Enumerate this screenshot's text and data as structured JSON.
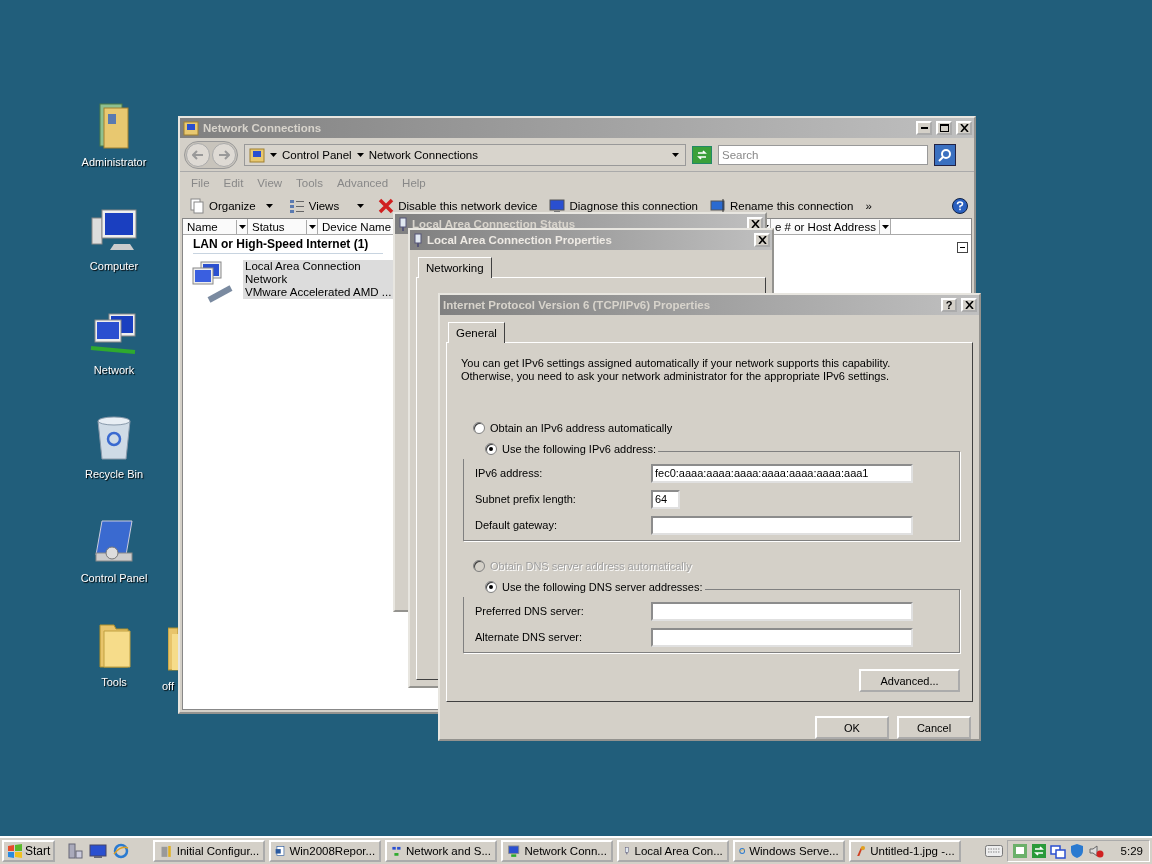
{
  "desktop_icons": [
    {
      "label": "Administrator",
      "kind": "user-folder"
    },
    {
      "label": "Computer",
      "kind": "computer"
    },
    {
      "label": "Network",
      "kind": "network"
    },
    {
      "label": "Recycle Bin",
      "kind": "bin"
    },
    {
      "label": "Control Panel",
      "kind": "control"
    },
    {
      "label": "Tools",
      "kind": "folder"
    }
  ],
  "hidden_icon": {
    "label": "off"
  },
  "explorer": {
    "title": "Network Connections",
    "breadcrumb": [
      "Control Panel",
      "Network Connections"
    ],
    "search": {
      "placeholder": "Search"
    },
    "menu": [
      "File",
      "Edit",
      "View",
      "Tools",
      "Advanced",
      "Help"
    ],
    "toolbar": [
      {
        "label": "Organize",
        "kind": "organize"
      },
      {
        "label": "Views",
        "kind": "views"
      },
      {
        "label": "Disable this network device",
        "kind": "disable"
      },
      {
        "label": "Diagnose this connection",
        "kind": "diagnose"
      },
      {
        "label": "Rename this connection",
        "kind": "rename"
      },
      {
        "label": "»",
        "kind": "more"
      }
    ],
    "columns": [
      "Name",
      "Status",
      "Device Name",
      "e # or Host Address"
    ],
    "group": {
      "title": "LAN or High-Speed Internet (1)",
      "expanded": true
    },
    "items": [
      {
        "lines": [
          "Local Area Connection",
          "Network",
          "VMware Accelerated AMD ..."
        ],
        "selected": true
      }
    ]
  },
  "status_dialog": {
    "title": "Local Area Connection Status"
  },
  "properties_dialog": {
    "title": "Local Area Connection Properties",
    "tabs": [
      {
        "label": "Networking",
        "selected": true
      }
    ]
  },
  "ipv6_dialog": {
    "title": "Internet Protocol Version 6 (TCP/IPv6) Properties",
    "help": "?",
    "tabs": [
      {
        "label": "General",
        "selected": true
      }
    ],
    "description": [
      "You can get IPv6 settings assigned automatically if your network supports this capability.",
      "Otherwise, you need to ask your network administrator for the appropriate IPv6 settings."
    ],
    "address_modes": [
      {
        "label": "Obtain an IPv6 address automatically",
        "selected": false,
        "disabled": false
      },
      {
        "label": "Use the following IPv6 address:",
        "selected": true,
        "disabled": false
      }
    ],
    "address_fields": [
      {
        "label": "IPv6 address:",
        "value": "fec0:aaaa:aaaa:aaaa:aaaa:aaaa:aaaa:aaa1",
        "kind": "wide"
      },
      {
        "label": "Subnet prefix length:",
        "value": "64",
        "kind": "short"
      },
      {
        "label": "Default gateway:",
        "kind": "wide"
      }
    ],
    "dns_modes": [
      {
        "label": "Obtain DNS server address automatically",
        "selected": false,
        "disabled": true
      },
      {
        "label": "Use the following DNS server addresses:",
        "selected": true,
        "disabled": false
      }
    ],
    "dns_fields": [
      {
        "label": "Preferred DNS server:",
        "kind": "wide"
      },
      {
        "label": "Alternate DNS server:",
        "kind": "wide"
      }
    ],
    "advanced": "Advanced...",
    "buttons": [
      "OK",
      "Cancel"
    ]
  },
  "taskbar": {
    "start": "Start",
    "tasks": [
      {
        "label": "Initial Configur...",
        "kind": "tools"
      },
      {
        "label": "Win2008Repor...",
        "kind": "document"
      },
      {
        "label": "Network and S...",
        "kind": "network"
      },
      {
        "label": "Network Conn...",
        "kind": "connections"
      },
      {
        "label": "Local Area Con...",
        "kind": "adapter"
      },
      {
        "label": "Windows Serve...",
        "kind": "browser"
      },
      {
        "label": "Untitled-1.jpg -...",
        "kind": "paint"
      }
    ],
    "clock": "5:29"
  }
}
